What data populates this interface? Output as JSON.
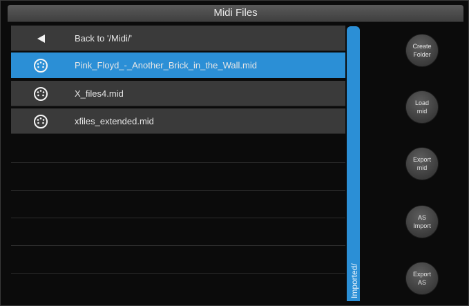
{
  "window": {
    "title": "Midi Files"
  },
  "list": {
    "back_label": "Back to '/Midi/'",
    "files": [
      {
        "name": "Pink_Floyd_-_Another_Brick_in_the_Wall.mid",
        "selected": true
      },
      {
        "name": "X_files4.mid",
        "selected": false
      },
      {
        "name": "xfiles_extended.mid",
        "selected": false
      }
    ]
  },
  "scrollbar": {
    "label": "Imported/"
  },
  "side_buttons": [
    {
      "label": "Create\nFolder"
    },
    {
      "label": "Load\nmid"
    },
    {
      "label": "Export\nmid"
    },
    {
      "label": "AS\nImport"
    },
    {
      "label": "Export\nAS"
    }
  ],
  "colors": {
    "accent": "#2b8fd6",
    "row": "#3a3a3a",
    "background": "#0b0b0b"
  },
  "icons": {
    "back": "left-arrow-icon",
    "file": "midi-connector-icon"
  }
}
